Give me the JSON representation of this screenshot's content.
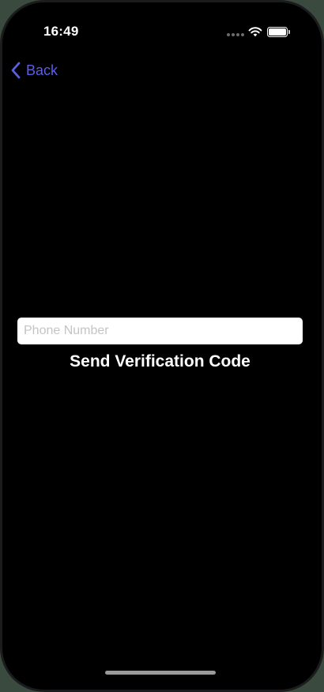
{
  "status_bar": {
    "time": "16:49",
    "icons": [
      "cellular-signal-icon",
      "wifi-icon",
      "battery-icon"
    ]
  },
  "nav": {
    "back_label": "Back",
    "back_icon": "chevron-left-icon",
    "accent_color": "#5b5fe6"
  },
  "form": {
    "phone_value": "",
    "phone_placeholder": "Phone Number",
    "send_label": "Send Verification Code"
  },
  "colors": {
    "background": "#000000",
    "input_background": "#ffffff",
    "button_text": "#ffffff"
  }
}
